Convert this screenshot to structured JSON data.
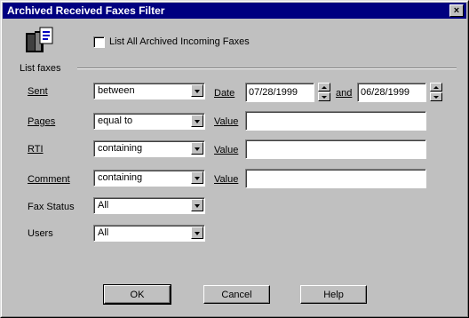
{
  "window": {
    "title": "Archived Received Faxes Filter",
    "close_glyph": "×"
  },
  "header": {
    "checkbox_label": "List All Archived Incoming Faxes",
    "checked": false,
    "group_label": "List faxes"
  },
  "rows": {
    "sent": {
      "label": "Sent",
      "operator": "between",
      "date_label": "Date",
      "date_from": "07/28/1999",
      "and_label": "and",
      "date_to": "06/28/1999"
    },
    "pages": {
      "label": "Pages",
      "operator": "equal to",
      "value_label": "Value",
      "value": ""
    },
    "rti": {
      "label": "RTI",
      "operator": "containing",
      "value_label": "Value",
      "value": ""
    },
    "comment": {
      "label": "Comment",
      "operator": "containing",
      "value_label": "Value",
      "value": ""
    },
    "fax_status": {
      "label": "Fax Status",
      "operator": "All"
    },
    "users": {
      "label": "Users",
      "operator": "All"
    }
  },
  "buttons": {
    "ok": "OK",
    "cancel": "Cancel",
    "help": "Help"
  },
  "icons": {
    "dialog_icon": "fax-archive-icon"
  }
}
